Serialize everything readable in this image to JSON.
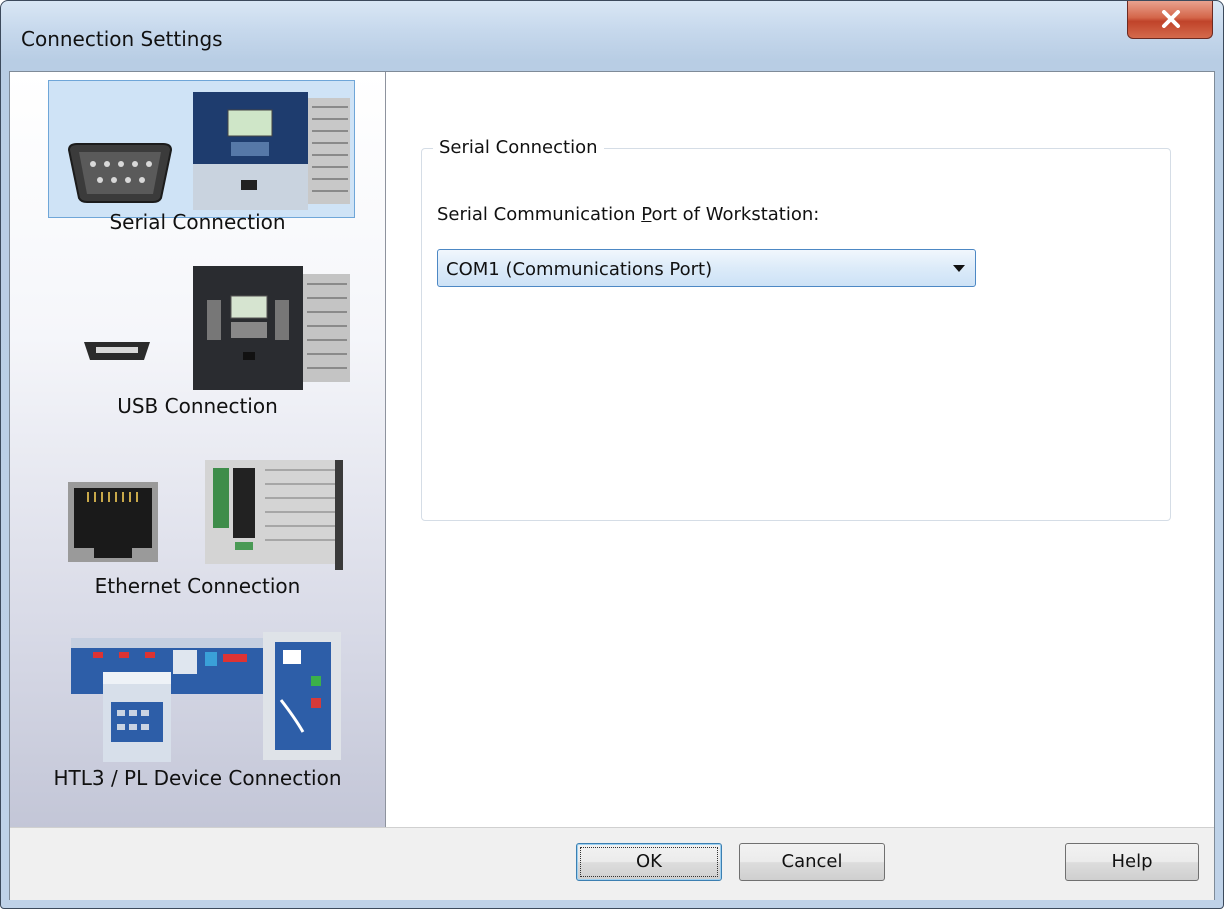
{
  "window": {
    "title": "Connection Settings"
  },
  "sidebar": {
    "items": [
      {
        "label": "Serial Connection",
        "selected": true
      },
      {
        "label": "USB Connection",
        "selected": false
      },
      {
        "label": "Ethernet Connection",
        "selected": false
      },
      {
        "label": "HTL3 / PL Device Connection",
        "selected": false
      }
    ]
  },
  "serial": {
    "group_title": "Serial Connection",
    "port_label_pre": "Serial Communication ",
    "port_label_accel": "P",
    "port_label_post": "ort of Workstation:",
    "port_value": "COM1 (Communications Port)"
  },
  "footer": {
    "ok_label": "OK",
    "cancel_label": "Cancel",
    "help_label": "Help"
  },
  "colors": {
    "selection": "#cfe3f6",
    "accent": "#4d88c4",
    "close": "#c0432a"
  }
}
